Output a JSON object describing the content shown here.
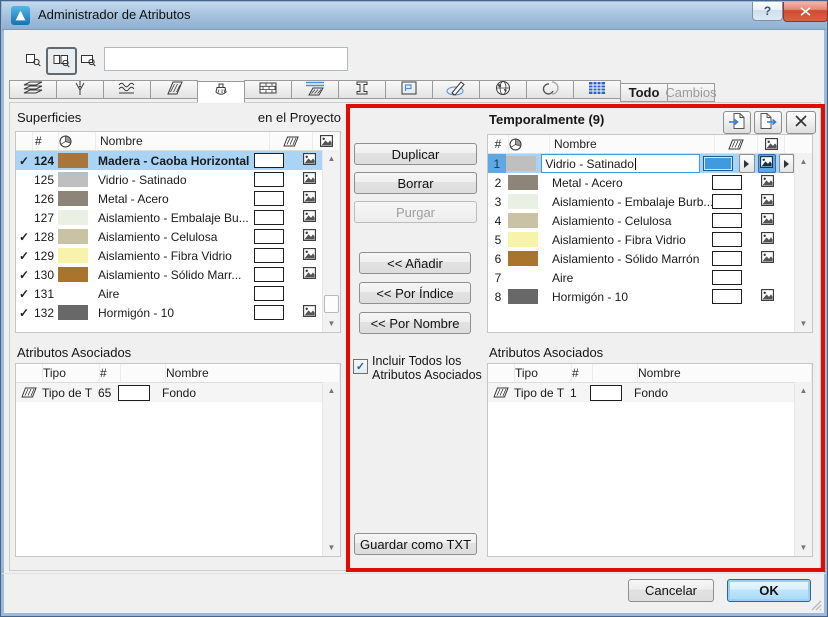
{
  "window": {
    "title": "Administrador de Atributos",
    "help_label": "?"
  },
  "search": {
    "value": "",
    "mode_icons": [
      "search-by-index",
      "search-by-index-and-name",
      "search-by-name"
    ],
    "selected_mode": 1
  },
  "tabs": {
    "icons": [
      "layers",
      "pens",
      "line-types",
      "fill-types",
      "surfaces",
      "composites",
      "building-materials",
      "profiles",
      "zones",
      "markup",
      "locations",
      "renovation",
      "schedules"
    ],
    "selected_index": 4,
    "todo_label": "Todo",
    "cambios_label": "Cambios"
  },
  "left_panel": {
    "title": "Superficies",
    "scope_label": "en el Proyecto",
    "header": {
      "num": "#",
      "name": "Nombre"
    },
    "rows": [
      {
        "checked": true,
        "num": "124",
        "color": "#a8763a",
        "name": "Madera - Caoba Horizontal",
        "selected": true,
        "has_texture": true
      },
      {
        "checked": false,
        "num": "125",
        "color": "#bfbfbf",
        "name": "Vidrio - Satinado",
        "selected": false,
        "has_texture": true
      },
      {
        "checked": false,
        "num": "126",
        "color": "#8d8577",
        "name": "Metal - Acero",
        "selected": false,
        "has_texture": true
      },
      {
        "checked": false,
        "num": "127",
        "color": "#eaf0e4",
        "name": "Aislamiento - Embalaje Bu...",
        "selected": false,
        "has_texture": true
      },
      {
        "checked": true,
        "num": "128",
        "color": "#c9c2a4",
        "name": "Aislamiento - Celulosa",
        "selected": false,
        "has_texture": true
      },
      {
        "checked": true,
        "num": "129",
        "color": "#f8f3ab",
        "name": "Aislamiento - Fibra Vidrio",
        "selected": false,
        "has_texture": true
      },
      {
        "checked": true,
        "num": "130",
        "color": "#a9752d",
        "name": "Aislamiento - Sólido Marr...",
        "selected": false,
        "has_texture": true
      },
      {
        "checked": true,
        "num": "131",
        "color": null,
        "name": "Aire",
        "selected": false,
        "has_texture": false
      },
      {
        "checked": true,
        "num": "132",
        "color": "#686868",
        "name": "Hormigón - 10",
        "selected": false,
        "has_texture": true
      }
    ],
    "assoc": {
      "title": "Atributos Asociados",
      "header": {
        "type": "Tipo",
        "num": "#",
        "name": "Nombre"
      },
      "rows": [
        {
          "type": "Tipo de T",
          "num": "65",
          "name": "Fondo"
        }
      ]
    }
  },
  "middle": {
    "duplicate": "Duplicar",
    "delete": "Borrar",
    "purge": "Purgar",
    "add": "<< Añadir",
    "by_index": "<< Por Índice",
    "by_name": "<< Por Nombre",
    "include_checkbox": "Incluir Todos los Atributos Asociados",
    "include_checked": true,
    "save_txt": "Guardar como TXT"
  },
  "right_panel": {
    "title": "Temporalmente (9)",
    "header": {
      "num": "#",
      "name": "Nombre"
    },
    "toolbar_icons": [
      "import-attributes",
      "export-attributes",
      "clear-list"
    ],
    "rows": [
      {
        "num": "1",
        "color": "#bfbfbf",
        "name": "Vidrio - Satinado",
        "selected": true,
        "has_texture": true
      },
      {
        "num": "2",
        "color": "#8d8577",
        "name": "Metal - Acero",
        "selected": false,
        "has_texture": true
      },
      {
        "num": "3",
        "color": "#eaf0e4",
        "name": "Aislamiento - Embalaje Burb...",
        "selected": false,
        "has_texture": true
      },
      {
        "num": "4",
        "color": "#c9c2a4",
        "name": "Aislamiento - Celulosa",
        "selected": false,
        "has_texture": true
      },
      {
        "num": "5",
        "color": "#f8f3ab",
        "name": "Aislamiento - Fibra Vidrio",
        "selected": false,
        "has_texture": true
      },
      {
        "num": "6",
        "color": "#a9752d",
        "name": "Aislamiento - Sólido Marrón",
        "selected": false,
        "has_texture": true
      },
      {
        "num": "7",
        "color": null,
        "name": "Aire",
        "selected": false,
        "has_texture": false
      },
      {
        "num": "8",
        "color": "#686868",
        "name": "Hormigón - 10",
        "selected": false,
        "has_texture": true
      }
    ],
    "assoc": {
      "title": "Atributos Asociados",
      "header": {
        "type": "Tipo",
        "num": "#",
        "name": "Nombre"
      },
      "rows": [
        {
          "type": "Tipo de T",
          "num": "1",
          "name": "Fondo"
        }
      ]
    }
  },
  "footer": {
    "cancel": "Cancelar",
    "ok": "OK"
  },
  "colors": {
    "selection": "#a9d4f5",
    "accent_blue": "#3f9be0",
    "red_frame": "#e10b00"
  }
}
